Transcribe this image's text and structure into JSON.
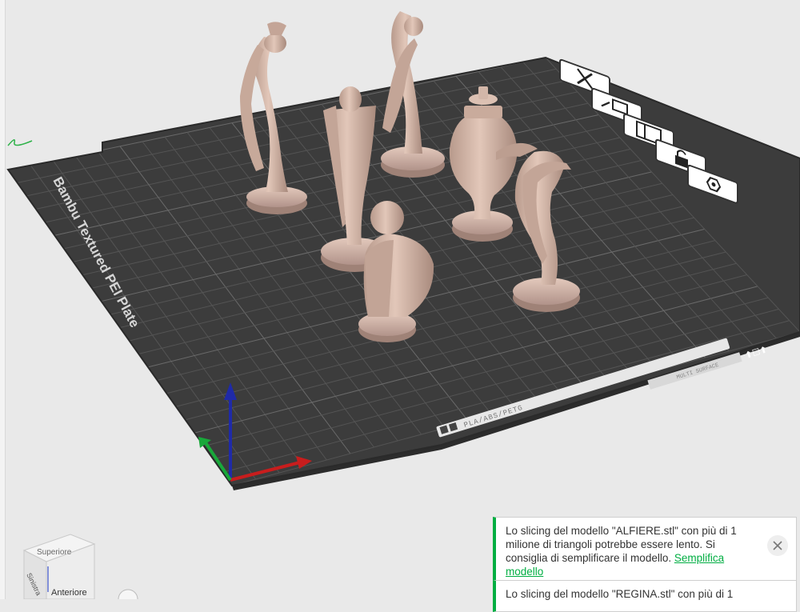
{
  "plate": {
    "label": "Bambu Textured PEI Plate",
    "filament_label": "PLA/ABS/PETG",
    "side_label": "MULTI SURFACE"
  },
  "toolbar_icons": [
    "close-plate-icon",
    "auto-arrange-icon",
    "layout-icon",
    "lock-icon",
    "settings-gear-icon"
  ],
  "view_cube": {
    "top": "Superiore",
    "front": "Anteriore",
    "left": "Sinistra"
  },
  "notifications": [
    {
      "text": "Lo slicing del modello \"ALFIERE.stl\" con più di 1 milione di triangoli potrebbe essere lento. Si consiglia di semplificare il modello. ",
      "link": "Semplifica modello"
    },
    {
      "text": "Lo slicing del modello \"REGINA.stl\" con più di 1",
      "link": ""
    }
  ],
  "colors": {
    "background": "#e9e9e9",
    "plate": "#3a3a3a",
    "grid": "#5a5a5a",
    "model": "#d6b8aa",
    "accent": "#00ae42"
  }
}
